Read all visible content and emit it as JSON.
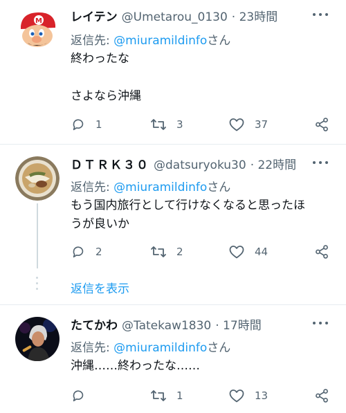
{
  "tweets": [
    {
      "name": "レイテン",
      "handle": "@Umetarou_0130",
      "time": "· 23時間",
      "reply_prefix": "返信先: ",
      "reply_user": "@miuramildinfo",
      "reply_suffix": "さん",
      "lines": [
        "終わったな",
        "",
        "さよなら沖縄"
      ],
      "replies": "1",
      "retweets": "3",
      "likes": "37"
    },
    {
      "name": "ＤＴＲＫ３０",
      "handle": "@datsuryoku30",
      "time": "· 22時間",
      "reply_prefix": "返信先: ",
      "reply_user": "@miuramildinfo",
      "reply_suffix": "さん",
      "lines": [
        "もう国内旅行として行けなくなると思ったほ",
        "うが良いか"
      ],
      "replies": "2",
      "retweets": "2",
      "likes": "44"
    },
    {
      "name": "たてかわ",
      "handle": "@Tatekaw1830",
      "time": "· 17時間",
      "reply_prefix": "返信先: ",
      "reply_user": "@miuramildinfo",
      "reply_suffix": "さん",
      "lines": [
        "沖縄……終わったな……"
      ],
      "replies": "",
      "retweets": "1",
      "likes": "13"
    }
  ],
  "show_replies_label": "返信を表示",
  "icons": {
    "reply": "reply-icon",
    "retweet": "retweet-icon",
    "like": "like-icon",
    "share": "share-icon",
    "more": "more-icon"
  },
  "colors": {
    "accent": "#1d9bf0",
    "secondary_text": "#536471",
    "divider": "#e6ecf0"
  }
}
